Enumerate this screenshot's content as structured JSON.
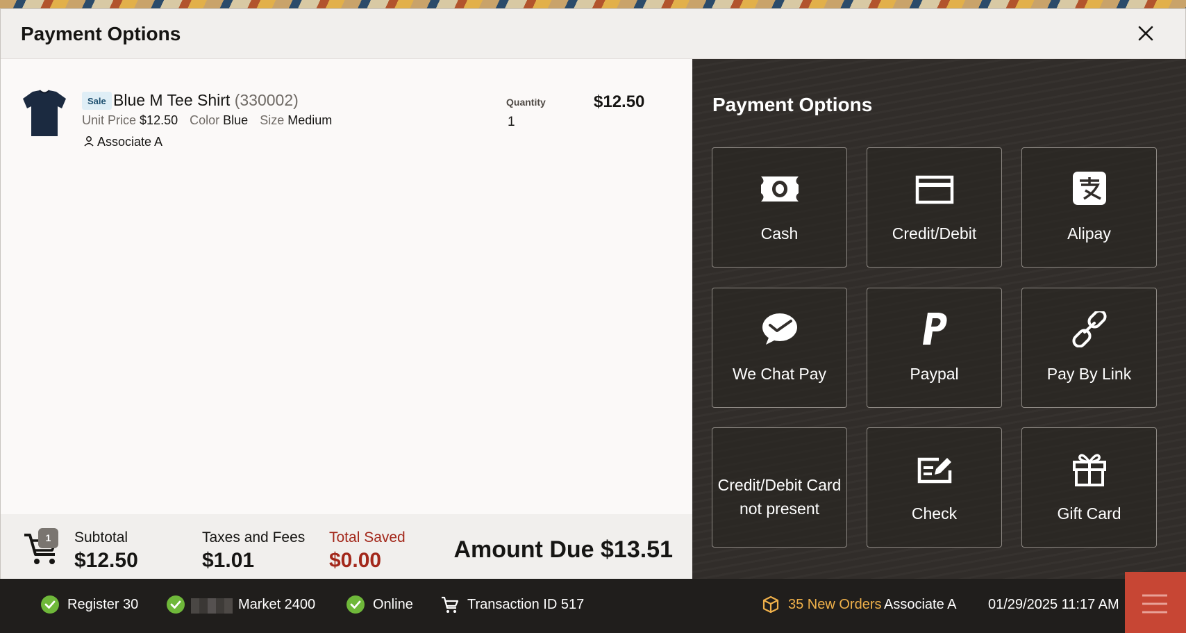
{
  "modal": {
    "title": "Payment Options",
    "close_icon": "close-icon"
  },
  "line_item": {
    "sale_badge": "Sale",
    "name": "Blue M Tee Shirt",
    "sku": "(330002)",
    "unit_price_label": "Unit Price",
    "unit_price": "$12.50",
    "color_label": "Color",
    "color": "Blue",
    "size_label": "Size",
    "size": "Medium",
    "associate": "Associate A",
    "quantity_label": "Quantity",
    "quantity": "1",
    "price": "$12.50"
  },
  "totals": {
    "cart_count": "1",
    "subtotal_label": "Subtotal",
    "subtotal": "$12.50",
    "taxes_label": "Taxes and Fees",
    "taxes": "$1.01",
    "saved_label": "Total Saved",
    "saved": "$0.00",
    "amount_due": "Amount Due $13.51"
  },
  "payment": {
    "title": "Payment Options",
    "options": [
      {
        "label": "Cash",
        "icon": "cash-icon"
      },
      {
        "label": "Credit/Debit",
        "icon": "credit-card-icon"
      },
      {
        "label": "Alipay",
        "icon": "alipay-icon"
      },
      {
        "label": "We Chat Pay",
        "icon": "wechat-pay-icon"
      },
      {
        "label": "Paypal",
        "icon": "paypal-icon"
      },
      {
        "label": "Pay By Link",
        "icon": "link-icon"
      },
      {
        "label": "Credit/Debit Card not present",
        "icon": "none"
      },
      {
        "label": "Check",
        "icon": "check-icon"
      },
      {
        "label": "Gift Card",
        "icon": "gift-icon"
      }
    ]
  },
  "statusbar": {
    "register": "Register 30",
    "market": "Market 2400",
    "online": "Online",
    "transaction": "Transaction ID 517",
    "orders": "35 New Orders",
    "associate": "Associate A",
    "datetime": "01/29/2025 11:17 AM"
  },
  "colors": {
    "accent_red": "#c74634",
    "saved_red": "#a3281b",
    "status_green": "#6fb83a",
    "orders_orange": "#f0b14a",
    "panel_dark": "#312d2a"
  }
}
